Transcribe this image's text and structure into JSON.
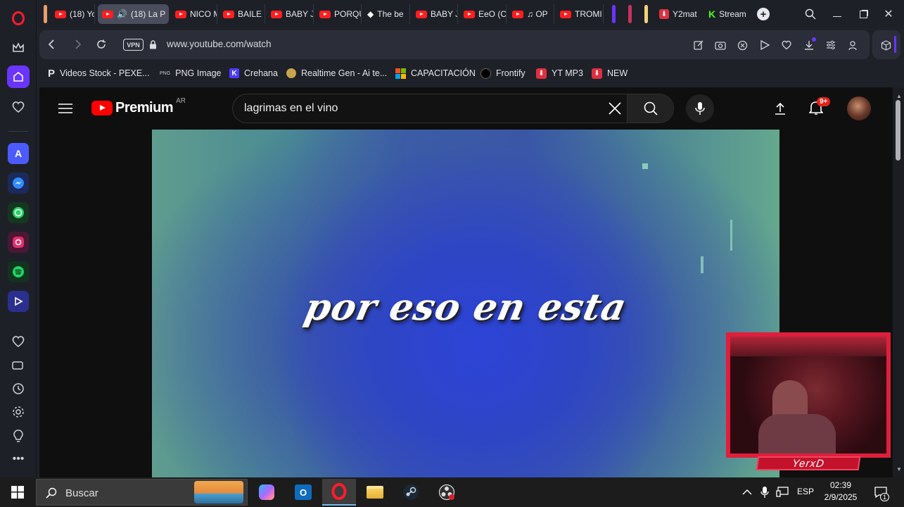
{
  "tabs": [
    {
      "title": "(18) Yo",
      "favicon": "youtube-icon",
      "active": false
    },
    {
      "title": "(18) La P",
      "favicon": "youtube-icon",
      "active": true,
      "audio": true
    },
    {
      "title": "NICO M",
      "favicon": "youtube-icon",
      "active": false
    },
    {
      "title": "BAILE I",
      "favicon": "youtube-icon",
      "active": false
    },
    {
      "title": "BABY J",
      "favicon": "youtube-icon",
      "active": false
    },
    {
      "title": "PORQU",
      "favicon": "youtube-icon",
      "active": false
    },
    {
      "title": "The be",
      "favicon": "diamond-icon",
      "active": false
    },
    {
      "title": "BABY J",
      "favicon": "youtube-icon",
      "active": false
    },
    {
      "title": "EeO (C",
      "favicon": "youtube-icon",
      "active": false
    },
    {
      "title": "♫ OP",
      "favicon": "youtube-icon",
      "active": false
    },
    {
      "title": "TROMI",
      "favicon": "youtube-icon",
      "active": false
    },
    {
      "title": "Y2mat",
      "favicon": "download-icon",
      "active": false
    },
    {
      "title": "Stream",
      "favicon": "kick-icon",
      "active": false
    }
  ],
  "address": {
    "vpn": "VPN",
    "url": "www.youtube.com/watch"
  },
  "bookmarks": [
    {
      "label": "Videos Stock - PEXE..."
    },
    {
      "label": "PNG Image"
    },
    {
      "label": "Crehana"
    },
    {
      "label": "Realtime Gen - Ai te..."
    },
    {
      "label": "CAPACITACIÓN"
    },
    {
      "label": "Frontify"
    },
    {
      "label": "YT MP3"
    },
    {
      "label": "NEW"
    }
  ],
  "youtube": {
    "logo_text": "Premium",
    "region": "AR",
    "search_value": "lagrimas en el vino",
    "notification_count": "9+",
    "lyric": "por eso en esta"
  },
  "webcam": {
    "name": "YerxD"
  },
  "taskbar": {
    "search_placeholder": "Buscar",
    "language": "ESP",
    "time": "02:39",
    "date": "2/9/2025",
    "notification_count": "1"
  },
  "colors": {
    "accent": "#6a35ff",
    "youtube_red": "#ff0000",
    "cam_frame": "#e01e3c"
  }
}
